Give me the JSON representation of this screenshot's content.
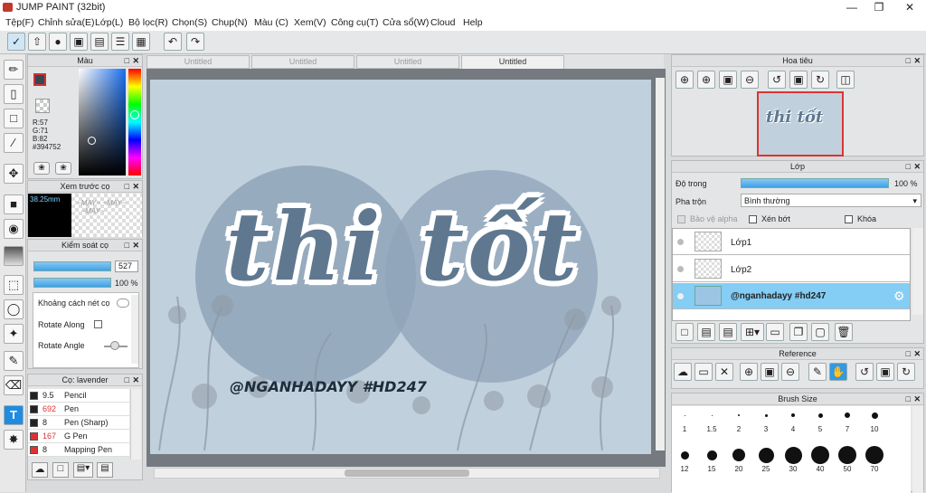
{
  "app": {
    "title": "JUMP PAINT (32bit)"
  },
  "menu": [
    "Tệp(F)",
    "Chỉnh sửa(E)",
    "Lớp(L)",
    "Bộ lọc(R)",
    "Chọn(S)",
    "Chụp(N)",
    "Màu (C)",
    "Xem(V)",
    "Công cụ(T)",
    "Cửa sổ(W)",
    "Cloud",
    "Help"
  ],
  "tabs": [
    "Untitled",
    "Untitled",
    "Untitled",
    "Untitled"
  ],
  "color_panel": {
    "title": "Màu",
    "r": "R:57",
    "g": "G:71",
    "b": "B:82",
    "hex": "#394752",
    "color": "#394752"
  },
  "preview_panel": {
    "title": "Xem trước cọ",
    "size": "38.25mm"
  },
  "control_panel": {
    "title": "Kiểm soát cọ",
    "size": "527",
    "opacity": "100 %",
    "opt1": "Khoảng cách nét cọ",
    "opt2": "Rotate Along",
    "opt3": "Rotate Angle"
  },
  "brush_panel": {
    "title": "Cọ: lavender",
    "items": [
      {
        "size": "9.5",
        "name": "Pencil",
        "color": "#222222"
      },
      {
        "size": "692",
        "name": "Pen",
        "color": "#222222"
      },
      {
        "size": "8",
        "name": "Pen (Sharp)",
        "color": "#222222"
      },
      {
        "size": "167",
        "name": "G Pen",
        "color": "#e03030"
      },
      {
        "size": "8",
        "name": "Mapping Pen",
        "color": "#e03030"
      }
    ]
  },
  "canvas": {
    "main_text": "thi tốt",
    "sub_text": "@NGANHADAYY #HD247"
  },
  "navigator": {
    "title": "Hoa tiêu"
  },
  "layer_panel": {
    "title": "Lớp",
    "opacity_label": "Độ trong",
    "opacity_value": "100 %",
    "blend_label": "Pha trộn",
    "blend_value": "Bình thường",
    "protect_alpha": "Bảo vệ alpha",
    "clip": "Xén bớt",
    "lock": "Khóa",
    "layers": [
      {
        "name": "Lớp1"
      },
      {
        "name": "Lớp2"
      },
      {
        "name": "@nganhadayy #hd247"
      }
    ]
  },
  "reference": {
    "title": "Reference"
  },
  "brush_size": {
    "title": "Brush Size",
    "sizes": [
      "1",
      "1.5",
      "2",
      "3",
      "4",
      "5",
      "7",
      "10",
      "12",
      "15",
      "20",
      "25",
      "30",
      "40",
      "50",
      "70"
    ]
  }
}
